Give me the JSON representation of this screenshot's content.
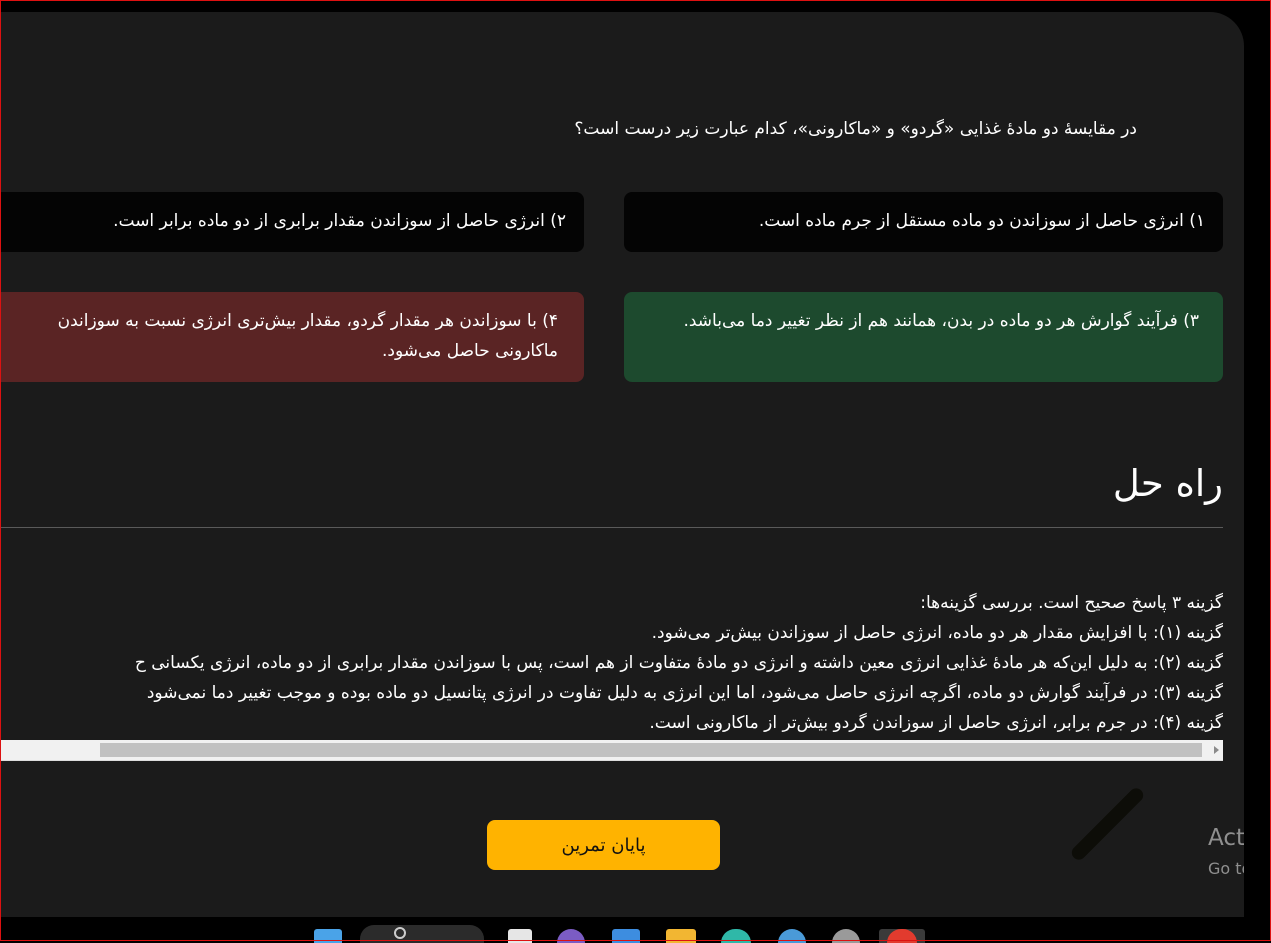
{
  "question": "در مقایسهٔ دو مادهٔ غذایی «گردو» و «ماکارونی»، کدام عبارت زیر درست است؟",
  "options": [
    {
      "label": "۱) انرژی حاصل از سوزاندن دو ماده مستقل از جرم ماده است.",
      "state": "neutral"
    },
    {
      "label": "۲) انرژی حاصل از سوزاندن مقدار برابری از دو ماده برابر است.",
      "state": "neutral"
    },
    {
      "label": "۳) فرآیند گوارش هر دو ماده در بدن، همانند هم از نظر تغییر دما می‌باشد.",
      "state": "correct"
    },
    {
      "label": "۴) با سوزاندن هر مقدار گردو، مقدار بیش‌تری انرژی نسبت به سوزاندن ماکارونی حاصل می‌شود.",
      "state": "wrong"
    }
  ],
  "solution": {
    "title": "راه حل",
    "lines": [
      "گزینه ۳ پاسخ صحیح است. بررسی گزینه‌ها:",
      "گزینه (۱): با افزایش مقدار هر دو ماده، انرژی حاصل از سوزاندن بیش‌تر می‌شود.",
      "گزینه (۲): به دلیل این‌که هر مادهٔ غذایی انرژی معین داشته و انرژی دو مادهٔ متفاوت از هم است، پس با سوزاندن مقدار برابری از دو ماده، انرژی یکسانی ح",
      "گزینه (۳): در فرآیند گوارش دو ماده، اگرچه انرژی حاصل می‌شود، اما این انرژی به دلیل تفاوت در انرژی پتانسیل دو ماده بوده و موجب تغییر دما نمی‌شود",
      "گزینه (۴): در جرم برابر، انرژی حاصل از سوزاندن گردو بیش‌تر از ماکارونی است."
    ]
  },
  "finish_button": "پایان تمرین",
  "watermark": {
    "line1": "Activa",
    "line2": "Go to Se"
  },
  "colors": {
    "correct": "#1d4a2e",
    "wrong": "#5a2424",
    "neutral": "#040404",
    "button": "#ffb300",
    "panel": "#1b1b1b"
  }
}
